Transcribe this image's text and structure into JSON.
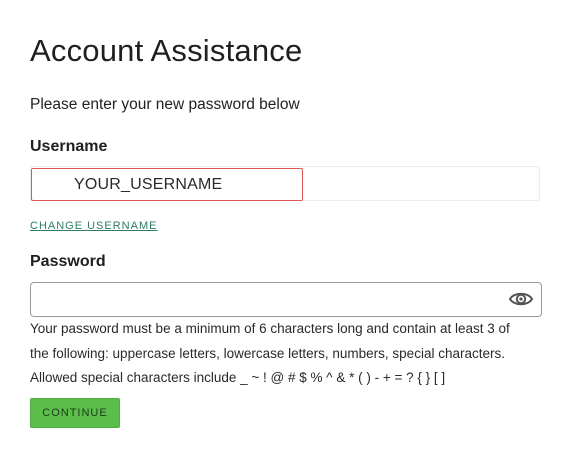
{
  "header": {
    "title": "Account Assistance",
    "subtitle": "Please enter your new password below"
  },
  "form": {
    "username_label": "Username",
    "username_value": "YOUR_USERNAME",
    "change_username_link": "CHANGE USERNAME",
    "password_label": "Password",
    "password_value": "",
    "password_toggle_icon": "eye-icon",
    "help_lines": [
      "Your password must be a minimum of 6 characters long and contain at least 3 of",
      "the following: uppercase letters, lowercase letters, numbers, special characters.",
      "Allowed special characters include _ ~ ! @ # $ % ^ & * ( ) - + = ? { } [ ]"
    ],
    "continue_label": "CONTINUE"
  },
  "colors": {
    "accent_green": "#5cbf4c",
    "link_green": "#2e7d64",
    "highlight_red": "#e05555"
  }
}
